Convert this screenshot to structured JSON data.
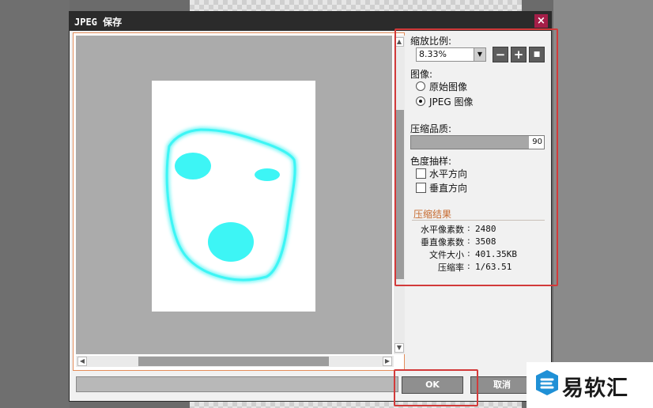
{
  "dialog": {
    "title": "JPEG 保存",
    "close_glyph": "×",
    "ok_label": "OK",
    "cancel_label": "取消"
  },
  "zoom": {
    "label": "缩放比例:",
    "value": "8.33%",
    "minus_glyph": "−",
    "plus_glyph": "+",
    "fit_glyph": "■"
  },
  "image": {
    "label": "图像:",
    "options": [
      "原始图像",
      "JPEG 图像"
    ],
    "selected": "JPEG 图像"
  },
  "quality": {
    "label": "压缩品质:",
    "value": "90"
  },
  "chroma": {
    "label": "色度抽样:",
    "options": [
      "水平方向",
      "垂直方向"
    ]
  },
  "result": {
    "title": "压缩结果",
    "rows": [
      {
        "key": "水平像素数",
        "value": "2480"
      },
      {
        "key": "垂直像素数",
        "value": "3508"
      },
      {
        "key": "文件大小",
        "value": "401.35KB"
      },
      {
        "key": "压缩率",
        "value": "1/63.51"
      }
    ]
  },
  "scroll": {
    "up": "▲",
    "down": "▼",
    "left": "◀",
    "right": "▶"
  },
  "watermark": {
    "text": "易软汇"
  },
  "colors": {
    "accent_orange": "#c66a2f",
    "highlight_red": "#d23a3a",
    "face_cyan": "#3df5f5"
  }
}
